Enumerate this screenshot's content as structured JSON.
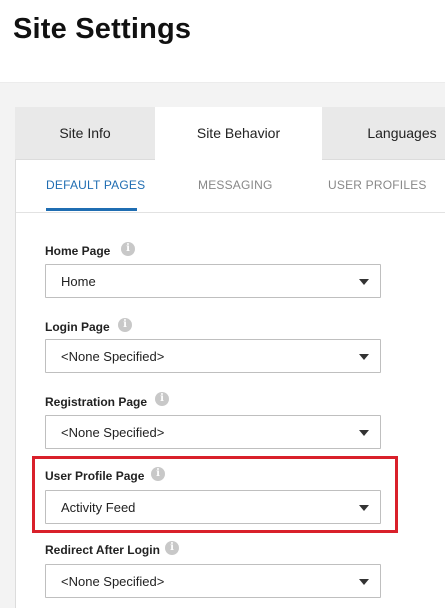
{
  "page": {
    "title": "Site Settings"
  },
  "tabs": [
    {
      "label": "Site Info",
      "active": false
    },
    {
      "label": "Site Behavior",
      "active": true
    },
    {
      "label": "Languages",
      "active": false
    }
  ],
  "subtabs": [
    {
      "label": "DEFAULT PAGES",
      "active": true
    },
    {
      "label": "MESSAGING",
      "active": false
    },
    {
      "label": "USER PROFILES",
      "active": false
    }
  ],
  "fields": [
    {
      "label": "Home Page",
      "value": "Home",
      "info_icon": "info-icon"
    },
    {
      "label": "Login Page",
      "value": "<None Specified>",
      "info_icon": "info-icon"
    },
    {
      "label": "Registration Page",
      "value": "<None Specified>",
      "info_icon": "info-icon"
    },
    {
      "label": "User Profile Page",
      "value": "Activity Feed",
      "info_icon": "info-icon",
      "highlighted": true
    },
    {
      "label": "Redirect After Login",
      "value": "<None Specified>",
      "info_icon": "info-icon"
    }
  ],
  "colors": {
    "accent": "#1f6db2",
    "highlight": "#d9202a"
  }
}
